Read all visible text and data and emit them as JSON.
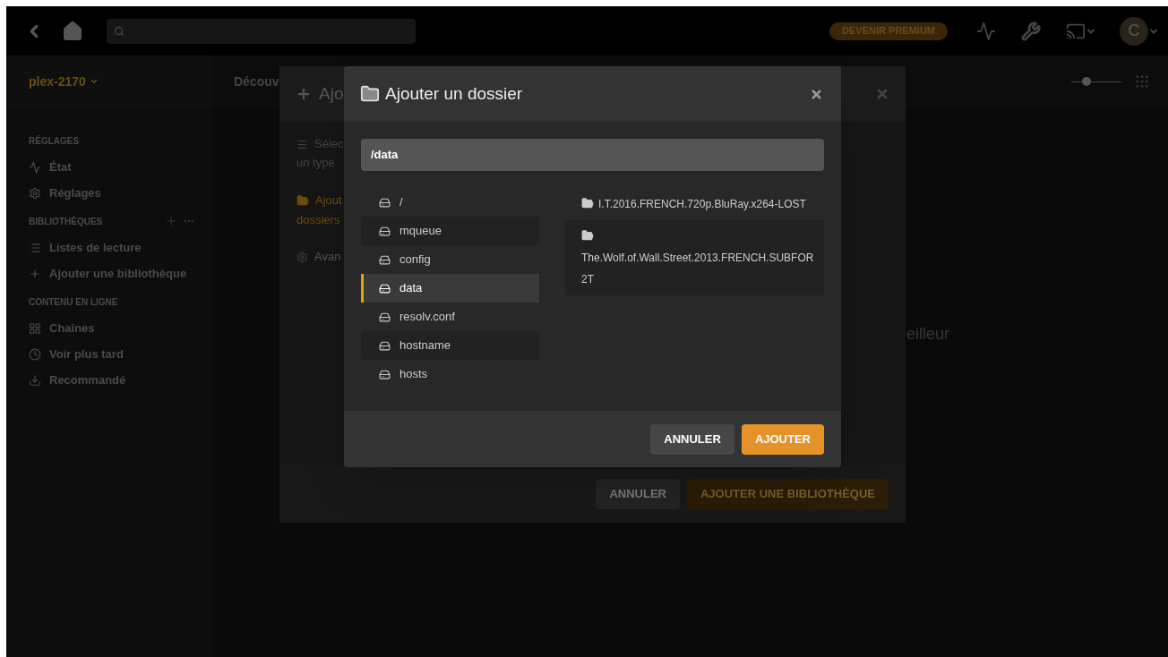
{
  "top_bar": {
    "premium_button": "DEVENIR PREMIUM",
    "avatar_letter": "C"
  },
  "sidebar": {
    "server": "plex-2170",
    "sections": [
      {
        "title": "RÉGLAGES",
        "items": [
          "État",
          "Réglages"
        ]
      },
      {
        "title": "BIBLIOTHÈQUES",
        "items": [
          "Listes de lecture",
          "Ajouter une bibliothèque"
        ]
      },
      {
        "title": "CONTENU EN LIGNE",
        "items": [
          "Chaînes",
          "Voir plus tard",
          "Recommandé"
        ]
      }
    ]
  },
  "main": {
    "tab": "Découv",
    "zoom_slider": {
      "level": 0.3
    },
    "background_text": "eilleur"
  },
  "library_dialog": {
    "title": "Ajo",
    "description": [
      "Sélec",
      "un type"
    ],
    "folder_link": [
      "Ajout",
      "dossiers"
    ],
    "advanced": "Avan",
    "cancel": "ANNULER",
    "submit": {
      "label": "AJOUTER UNE BIBLIOTHÈQUE",
      "disabled": true
    }
  },
  "folder_dialog": {
    "title": "Ajouter un dossier",
    "path": "/data",
    "locations": [
      {
        "name": "/",
        "selected": false
      },
      {
        "name": "mqueue",
        "selected": false
      },
      {
        "name": "config",
        "selected": false
      },
      {
        "name": "data",
        "selected": true
      },
      {
        "name": "resolv.conf",
        "selected": false
      },
      {
        "name": "hostname",
        "selected": false
      },
      {
        "name": "hosts",
        "selected": false
      }
    ],
    "folders": [
      {
        "name": "I.T.2016.FRENCH.720p.BluRay.x264-LOST"
      },
      {
        "name": "The.Wolf.of.Wall.Street.2013.FRENCH.SUBFOR 2T"
      }
    ],
    "cancel": "ANNULER",
    "submit": "AJOUTER"
  }
}
